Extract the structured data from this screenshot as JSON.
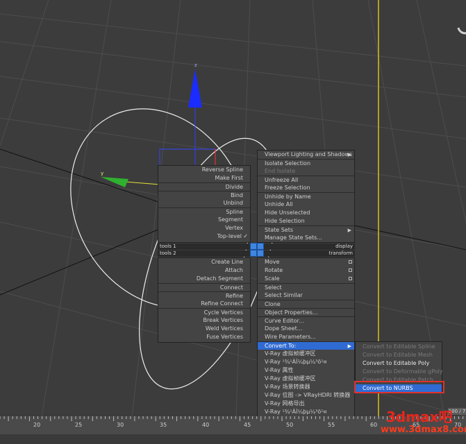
{
  "viewport": {
    "axis_label_z": "z",
    "axis_label_y": "y"
  },
  "menu_left": {
    "items": [
      {
        "label": "Reverse Spline"
      },
      {
        "label": "Make First"
      },
      {
        "label": "Divide"
      },
      {
        "label": "Bind"
      },
      {
        "label": "Unbind"
      },
      {
        "label": "Spline"
      },
      {
        "label": "Segment"
      },
      {
        "label": "Vertex"
      },
      {
        "label": "Top-level"
      }
    ],
    "tools1": "tools 1",
    "tools2": "tools 2",
    "items2": [
      {
        "label": "Create Line"
      },
      {
        "label": "Attach"
      },
      {
        "label": "Detach Segment"
      },
      {
        "label": "Connect"
      },
      {
        "label": "Refine"
      },
      {
        "label": "Refine Connect"
      },
      {
        "label": "Cycle Vertices"
      },
      {
        "label": "Break Vertices"
      },
      {
        "label": "Weld Vertices"
      },
      {
        "label": "Fuse Vertices"
      }
    ]
  },
  "menu_right": {
    "items": [
      {
        "label": "Viewport Lighting and Shadows"
      },
      {
        "label": "Isolate Selection"
      },
      {
        "label": "End Isolate"
      },
      {
        "label": "Unfreeze All"
      },
      {
        "label": "Freeze Selection"
      },
      {
        "label": "Unhide by Name"
      },
      {
        "label": "Unhide All"
      },
      {
        "label": "Hide Unselected"
      },
      {
        "label": "Hide Selection"
      },
      {
        "label": "State Sets"
      },
      {
        "label": "Manage State Sets..."
      }
    ],
    "display": "display",
    "transform": "transform",
    "items2": [
      {
        "label": "Move"
      },
      {
        "label": "Rotate"
      },
      {
        "label": "Scale"
      },
      {
        "label": "Select"
      },
      {
        "label": "Select Similar"
      },
      {
        "label": "Clone"
      },
      {
        "label": "Object Properties..."
      },
      {
        "label": "Curve Editor..."
      },
      {
        "label": "Dope Sheet..."
      },
      {
        "label": "Wire Parameters..."
      },
      {
        "label": "Convert To:"
      },
      {
        "label": "V-Ray 虚拟帧缓冲区"
      },
      {
        "label": "V-Ray ¹¾¹ÀÌ¼þµ¼³ö¹¤"
      },
      {
        "label": "V-Ray 属性"
      },
      {
        "label": "V-Ray 虚拟帧缓冲区"
      },
      {
        "label": "V-Ray 场景转换器"
      },
      {
        "label": "V-Ray 位图 -> VRayHDRI 转换器"
      },
      {
        "label": "V-Ray 网格导出"
      },
      {
        "label": "V-Ray ¹¾¹ÀÌ¼þµ¼³ö¹¤"
      }
    ]
  },
  "submenu": {
    "items": [
      {
        "label": "Convert to Editable Spline"
      },
      {
        "label": "Convert to Editable Mesh"
      },
      {
        "label": "Convert to Editable Poly"
      },
      {
        "label": "Convert to Deformable gPoly"
      },
      {
        "label": "Convert to Editable Patch"
      },
      {
        "label": "Convert to NURBS"
      }
    ]
  },
  "timeline": {
    "ticks": [
      "20",
      "25",
      "30",
      "35",
      "40",
      "45",
      "50",
      "55",
      "60",
      "65",
      "70"
    ],
    "frame_display": "100 / 7"
  },
  "watermark": {
    "line1": "3dmax吧",
    "line2": "www.3dmax8.com"
  },
  "colors": {
    "highlight": "#2f6bd3",
    "menu_bg": "#444444",
    "watermark": "#e8261b"
  }
}
